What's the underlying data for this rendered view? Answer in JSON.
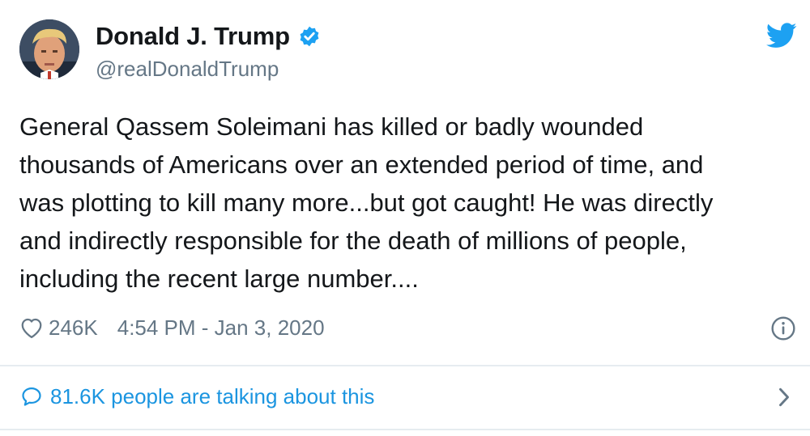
{
  "author": {
    "display_name": "Donald J. Trump",
    "handle": "@realDonaldTrump",
    "verified": true
  },
  "icons": {
    "avatar": "profile-photo",
    "verified": "verified-badge-icon",
    "brand": "twitter-bird-icon",
    "like": "heart-icon",
    "info": "info-icon",
    "conversation": "speech-bubble-icon",
    "more": "chevron-right-icon"
  },
  "tweet": {
    "lines": [
      "General Qassem Soleimani has killed or badly wounded",
      "thousands of Americans over an extended period of time, and",
      "was plotting to kill many more...but got caught! He was directly",
      "and indirectly responsible for the death of millions of people,",
      "including the recent large number...."
    ]
  },
  "meta": {
    "likes": "246K",
    "timestamp": "4:54 PM - Jan 3, 2020"
  },
  "conversation": {
    "label": "81.6K people are talking about this"
  },
  "colors": {
    "text": "#14171a",
    "secondary": "#657786",
    "accent": "#1da1f2",
    "link": "#1b95e0",
    "divider": "#e6ecf0"
  }
}
